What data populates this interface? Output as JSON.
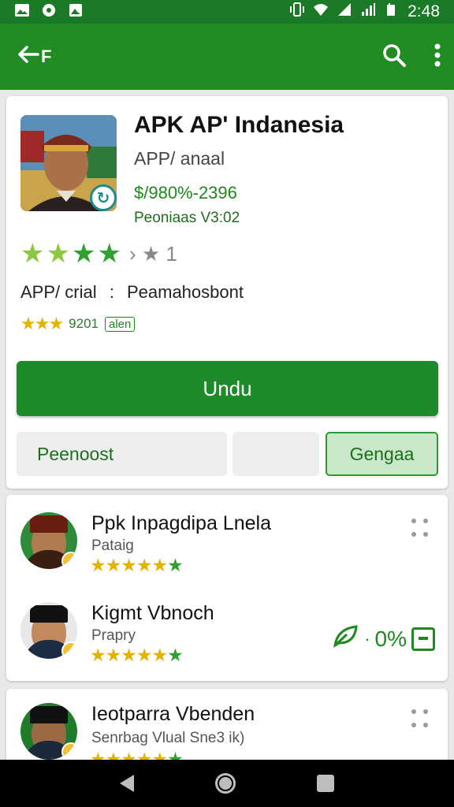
{
  "status_bar": {
    "time": "2:48",
    "left_icons": [
      "gallery-icon",
      "circle-app-icon",
      "photo-icon"
    ],
    "right_icons": [
      "vibrate-icon",
      "wifi-icon",
      "signal-icon",
      "signal-icon",
      "battery-icon"
    ]
  },
  "toolbar": {
    "back_label": "F",
    "icons": [
      "back-arrow-icon",
      "search-icon",
      "overflow-menu-icon"
    ]
  },
  "app": {
    "title": "APK AP' Indanesia",
    "subtitle": "APP/ anaal",
    "price": "$/980%-2396",
    "version": "Peoniaas V3:02",
    "rating_tail": "› ★ 1",
    "meta_label": "APP/ crial",
    "meta_sep": ":",
    "meta_value": "Peamahosbont",
    "small_count": "9201",
    "small_tag": "alen",
    "install_label": "Undu",
    "btn_left": "Peenoost",
    "btn_middle": "",
    "btn_right": "Gengaa"
  },
  "reviews": [
    {
      "name": "Ppk Inpagdipa Lnela",
      "sub": "Pataig",
      "stars": "★★★★★",
      "last_star": "★"
    },
    {
      "name": "Kigmt Vbnoch",
      "sub": "Prapry",
      "stars": "★★★★★",
      "last_star": "★",
      "share_text": "0%",
      "share_dash": "·"
    },
    {
      "name": "Ieotparra Vbenden",
      "sub": "Senrbag Vlual Sne3 ik)",
      "stars": "★★★★★",
      "last_star": "★"
    }
  ],
  "colors": {
    "toolbar": "#228b22",
    "statusbar": "#1a7a26",
    "accent_green": "#1f8a2a",
    "star_yellow": "#e2b300"
  }
}
